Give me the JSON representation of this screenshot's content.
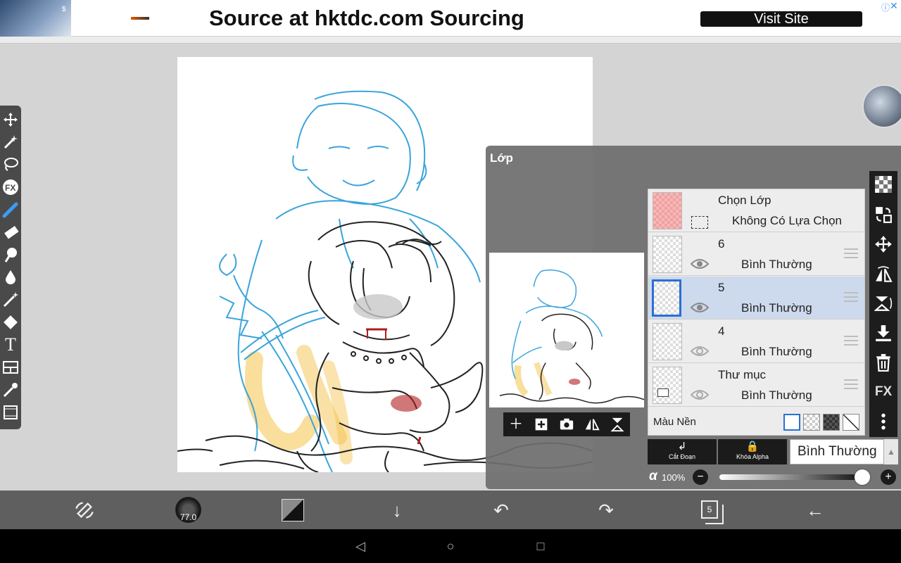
{
  "ad": {
    "title": "Source at hktdc.com Sourcing",
    "button": "Visit Site",
    "info_icon": "info-icon",
    "close_icon": "close-icon",
    "thumb_text": "$"
  },
  "layer_panel": {
    "title": "Lớp",
    "select_row": {
      "title": "Chọn Lớp",
      "subtitle": "Không Có Lựa Chọn"
    },
    "layers": [
      {
        "name": "6",
        "mode": "Bình Thường",
        "selected": false
      },
      {
        "name": "5",
        "mode": "Bình Thường",
        "selected": true
      },
      {
        "name": "4",
        "mode": "Bình Thường",
        "selected": false
      },
      {
        "name": "Thư mục",
        "mode": "Bình Thường",
        "selected": false
      }
    ],
    "background_label": "Màu Nền",
    "clip_label": "Cắt Đoạn",
    "alpha_lock_label": "Khóa Alpha",
    "blend_mode": "Bình Thường",
    "opacity_symbol": "α",
    "opacity_value": "100%",
    "opacity_fraction": 1.0,
    "minus": "−",
    "plus": "+"
  },
  "bottom_bar": {
    "brush_size": "77.0",
    "layer_count": "5"
  },
  "right_toolbar": {
    "fx_label": "FX"
  },
  "left_toolbar": {
    "fx_label": "FX",
    "text_label": "T"
  },
  "colors": {
    "accent": "#2b6fd6",
    "panel_bg": "#6e6e6e",
    "sketch_blue": "#3aa4dc",
    "highlight_yellow": "#f4c24a",
    "blood_red": "#b01e1e"
  }
}
